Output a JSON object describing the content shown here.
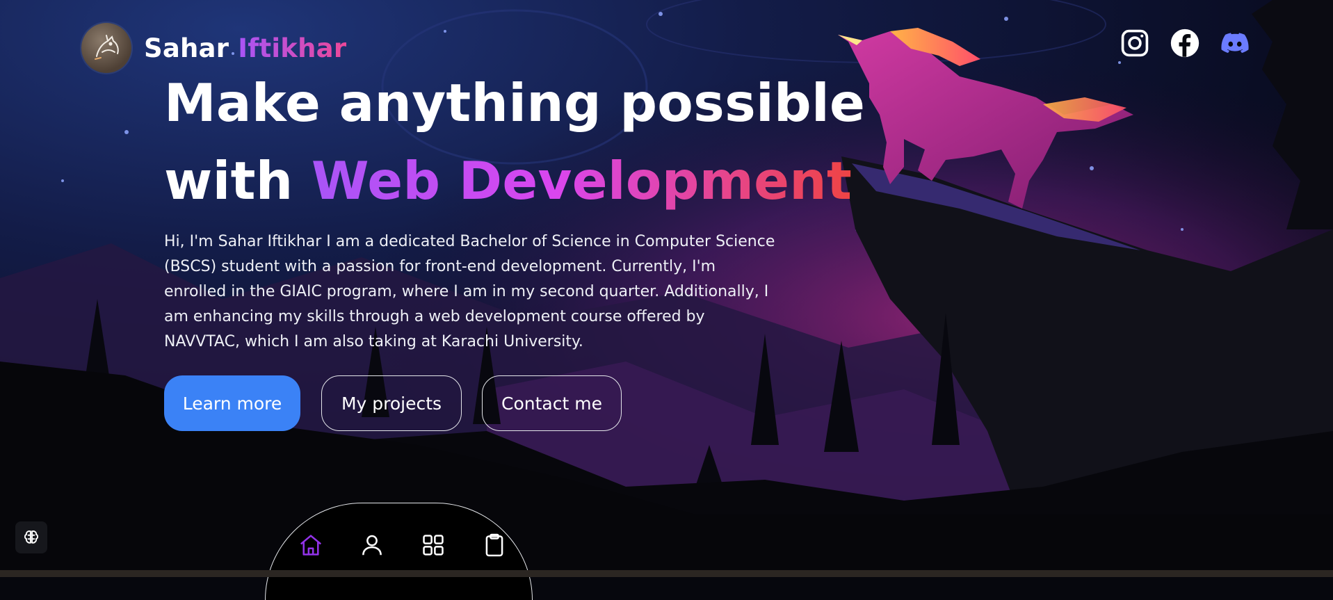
{
  "header": {
    "first_name": "Sahar",
    "last_name": "Iftikhar",
    "logo_icon": "horse-head-logo"
  },
  "socials": [
    {
      "name": "instagram-icon"
    },
    {
      "name": "facebook-icon"
    },
    {
      "name": "discord-icon",
      "color": "#6b7cff"
    }
  ],
  "hero": {
    "title_line1": "Make anything possible",
    "title_line2_prefix": "with",
    "title_line2_highlight": "Web Development",
    "intro": "Hi, I'm Sahar Iftikhar I am a dedicated Bachelor of Science in Computer Science (BSCS) student with a passion for front-end development. Currently, I'm enrolled in the GIAIC program, where I am in my second quarter. Additionally, I am enhancing my skills through a web development course offered by NAVVTAC, which I am also taking at Karachi University."
  },
  "buttons": {
    "learn_more": "Learn more",
    "my_projects": "My projects",
    "contact_me": "Contact me"
  },
  "bottom_nav": {
    "items": [
      "home-icon",
      "user-icon",
      "grid-icon",
      "clipboard-icon"
    ],
    "active": "home-icon",
    "active_color": "#9333ea"
  },
  "colors": {
    "accent_blue": "#3b82f6",
    "gradient_purple": "#a855f7",
    "gradient_red": "#ef4444"
  }
}
